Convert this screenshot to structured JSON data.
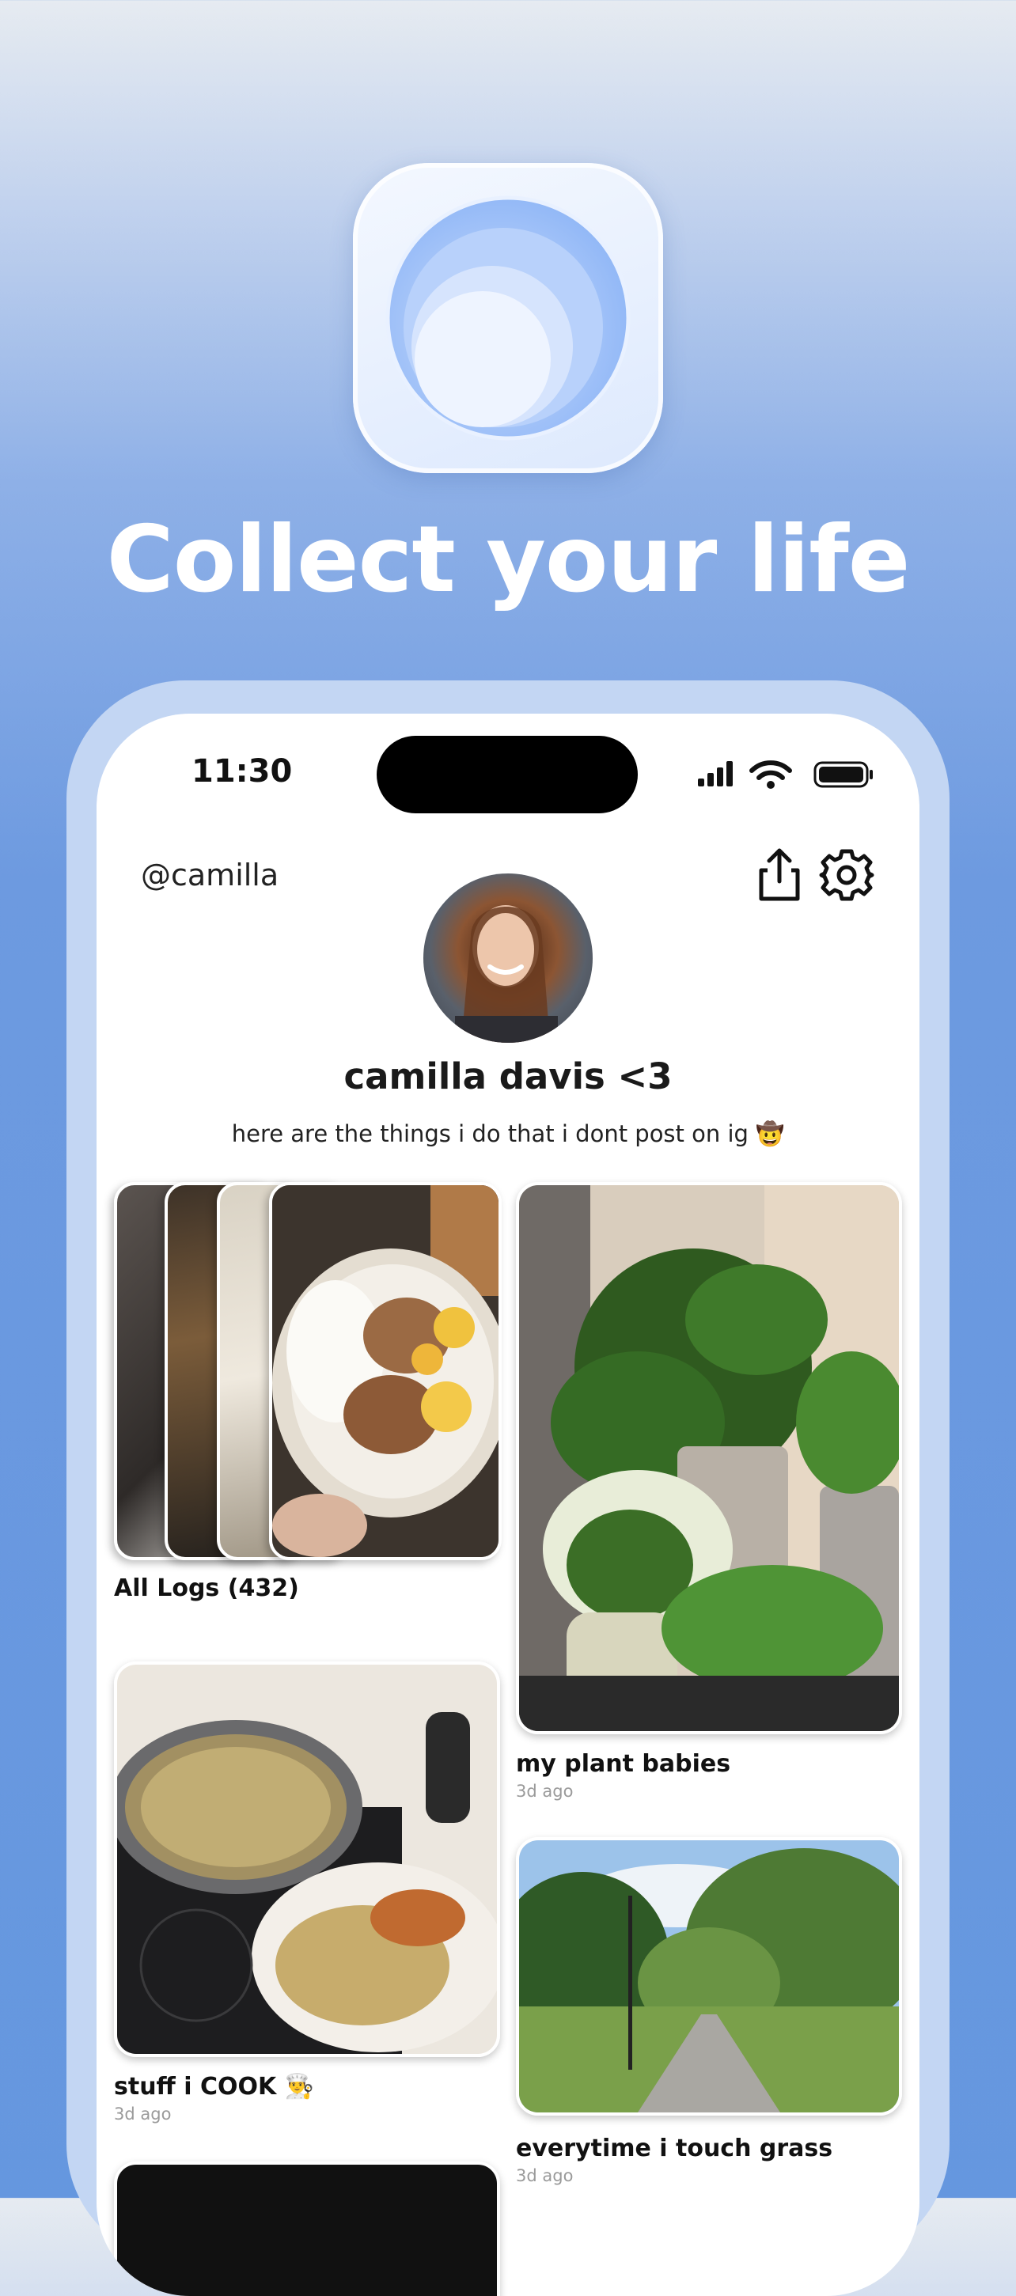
{
  "headline": "Collect your life",
  "status_bar": {
    "time": "11:30"
  },
  "profile": {
    "handle": "@camilla",
    "name": "camilla davis <3",
    "bio": "here are the things i do that i dont post on ig 🤠"
  },
  "icons": {
    "share": "share-icon",
    "settings": "gear-icon",
    "signal": "signal-icon",
    "wifi": "wifi-icon",
    "battery": "battery-icon"
  },
  "collections": [
    {
      "title": "All Logs (432)",
      "time": ""
    },
    {
      "title": "my plant babies",
      "time": "3d ago"
    },
    {
      "title": "stuff i COOK 👨‍🍳",
      "time": "3d ago"
    },
    {
      "title": "everytime i touch grass",
      "time": "3d ago"
    }
  ],
  "colors": {
    "background": "#6597df",
    "phone_frame": "#c3d6f3",
    "accent": "#8fb6f6"
  }
}
